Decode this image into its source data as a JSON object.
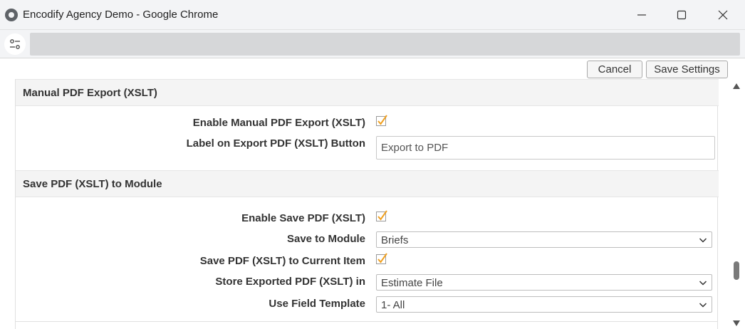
{
  "window": {
    "title": "Encodify Agency Demo - Google Chrome",
    "icons": {
      "app": "chrome-icon",
      "minimize": "minimize-icon",
      "maximize": "maximize-icon",
      "close": "close-icon",
      "tune": "tune-icon"
    }
  },
  "toolbar": {
    "cancel_label": "Cancel",
    "save_label": "Save Settings"
  },
  "sections": {
    "manual": {
      "title": "Manual PDF Export (XSLT)",
      "enable_label": "Enable Manual PDF Export (XSLT)",
      "enable_checked": true,
      "button_label_label": "Label on Export PDF (XSLT) Button",
      "button_label_value": "Export to PDF"
    },
    "save": {
      "title": "Save PDF (XSLT) to Module",
      "enable_label": "Enable Save PDF (XSLT)",
      "enable_checked": true,
      "module_label": "Save to Module",
      "module_value": "Briefs",
      "current_item_label": "Save PDF (XSLT) to Current Item",
      "current_item_checked": true,
      "store_label": "Store Exported PDF (XSLT) in",
      "store_value": "Estimate File",
      "template_label": "Use Field Template",
      "template_value": "1- All"
    }
  },
  "colors": {
    "checkmark": "#f0a020",
    "checkbox_border": "#9a9a9a",
    "section_bg": "#f4f4f4"
  }
}
